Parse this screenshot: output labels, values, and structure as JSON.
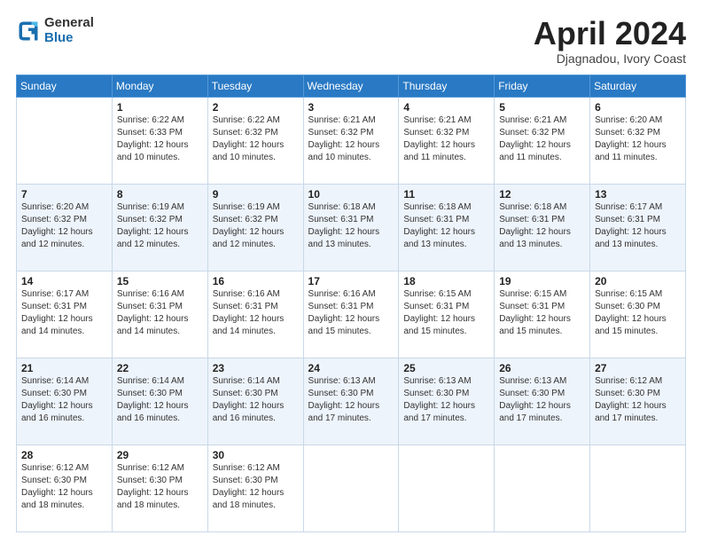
{
  "logo": {
    "general": "General",
    "blue": "Blue"
  },
  "title": {
    "month_year": "April 2024",
    "location": "Djagnadou, Ivory Coast"
  },
  "days_of_week": [
    "Sunday",
    "Monday",
    "Tuesday",
    "Wednesday",
    "Thursday",
    "Friday",
    "Saturday"
  ],
  "weeks": [
    [
      {
        "day": "",
        "info": ""
      },
      {
        "day": "1",
        "info": "Sunrise: 6:22 AM\nSunset: 6:33 PM\nDaylight: 12 hours\nand 10 minutes."
      },
      {
        "day": "2",
        "info": "Sunrise: 6:22 AM\nSunset: 6:32 PM\nDaylight: 12 hours\nand 10 minutes."
      },
      {
        "day": "3",
        "info": "Sunrise: 6:21 AM\nSunset: 6:32 PM\nDaylight: 12 hours\nand 10 minutes."
      },
      {
        "day": "4",
        "info": "Sunrise: 6:21 AM\nSunset: 6:32 PM\nDaylight: 12 hours\nand 11 minutes."
      },
      {
        "day": "5",
        "info": "Sunrise: 6:21 AM\nSunset: 6:32 PM\nDaylight: 12 hours\nand 11 minutes."
      },
      {
        "day": "6",
        "info": "Sunrise: 6:20 AM\nSunset: 6:32 PM\nDaylight: 12 hours\nand 11 minutes."
      }
    ],
    [
      {
        "day": "7",
        "info": "Sunrise: 6:20 AM\nSunset: 6:32 PM\nDaylight: 12 hours\nand 12 minutes."
      },
      {
        "day": "8",
        "info": "Sunrise: 6:19 AM\nSunset: 6:32 PM\nDaylight: 12 hours\nand 12 minutes."
      },
      {
        "day": "9",
        "info": "Sunrise: 6:19 AM\nSunset: 6:32 PM\nDaylight: 12 hours\nand 12 minutes."
      },
      {
        "day": "10",
        "info": "Sunrise: 6:18 AM\nSunset: 6:31 PM\nDaylight: 12 hours\nand 13 minutes."
      },
      {
        "day": "11",
        "info": "Sunrise: 6:18 AM\nSunset: 6:31 PM\nDaylight: 12 hours\nand 13 minutes."
      },
      {
        "day": "12",
        "info": "Sunrise: 6:18 AM\nSunset: 6:31 PM\nDaylight: 12 hours\nand 13 minutes."
      },
      {
        "day": "13",
        "info": "Sunrise: 6:17 AM\nSunset: 6:31 PM\nDaylight: 12 hours\nand 13 minutes."
      }
    ],
    [
      {
        "day": "14",
        "info": "Sunrise: 6:17 AM\nSunset: 6:31 PM\nDaylight: 12 hours\nand 14 minutes."
      },
      {
        "day": "15",
        "info": "Sunrise: 6:16 AM\nSunset: 6:31 PM\nDaylight: 12 hours\nand 14 minutes."
      },
      {
        "day": "16",
        "info": "Sunrise: 6:16 AM\nSunset: 6:31 PM\nDaylight: 12 hours\nand 14 minutes."
      },
      {
        "day": "17",
        "info": "Sunrise: 6:16 AM\nSunset: 6:31 PM\nDaylight: 12 hours\nand 15 minutes."
      },
      {
        "day": "18",
        "info": "Sunrise: 6:15 AM\nSunset: 6:31 PM\nDaylight: 12 hours\nand 15 minutes."
      },
      {
        "day": "19",
        "info": "Sunrise: 6:15 AM\nSunset: 6:31 PM\nDaylight: 12 hours\nand 15 minutes."
      },
      {
        "day": "20",
        "info": "Sunrise: 6:15 AM\nSunset: 6:30 PM\nDaylight: 12 hours\nand 15 minutes."
      }
    ],
    [
      {
        "day": "21",
        "info": "Sunrise: 6:14 AM\nSunset: 6:30 PM\nDaylight: 12 hours\nand 16 minutes."
      },
      {
        "day": "22",
        "info": "Sunrise: 6:14 AM\nSunset: 6:30 PM\nDaylight: 12 hours\nand 16 minutes."
      },
      {
        "day": "23",
        "info": "Sunrise: 6:14 AM\nSunset: 6:30 PM\nDaylight: 12 hours\nand 16 minutes."
      },
      {
        "day": "24",
        "info": "Sunrise: 6:13 AM\nSunset: 6:30 PM\nDaylight: 12 hours\nand 17 minutes."
      },
      {
        "day": "25",
        "info": "Sunrise: 6:13 AM\nSunset: 6:30 PM\nDaylight: 12 hours\nand 17 minutes."
      },
      {
        "day": "26",
        "info": "Sunrise: 6:13 AM\nSunset: 6:30 PM\nDaylight: 12 hours\nand 17 minutes."
      },
      {
        "day": "27",
        "info": "Sunrise: 6:12 AM\nSunset: 6:30 PM\nDaylight: 12 hours\nand 17 minutes."
      }
    ],
    [
      {
        "day": "28",
        "info": "Sunrise: 6:12 AM\nSunset: 6:30 PM\nDaylight: 12 hours\nand 18 minutes."
      },
      {
        "day": "29",
        "info": "Sunrise: 6:12 AM\nSunset: 6:30 PM\nDaylight: 12 hours\nand 18 minutes."
      },
      {
        "day": "30",
        "info": "Sunrise: 6:12 AM\nSunset: 6:30 PM\nDaylight: 12 hours\nand 18 minutes."
      },
      {
        "day": "",
        "info": ""
      },
      {
        "day": "",
        "info": ""
      },
      {
        "day": "",
        "info": ""
      },
      {
        "day": "",
        "info": ""
      }
    ]
  ]
}
